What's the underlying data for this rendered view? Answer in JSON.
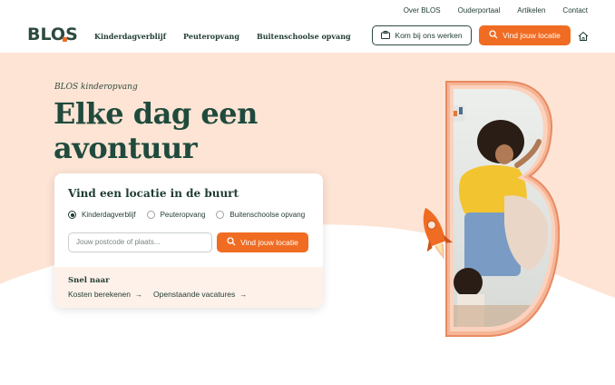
{
  "top_links": [
    "Over BLOS",
    "Ouderportaal",
    "Artikelen",
    "Contact"
  ],
  "logo": {
    "text": "BLOS"
  },
  "main_nav": [
    "Kinderdagverblijf",
    "Peuteropvang",
    "Buitenschoolse opvang"
  ],
  "header_buttons": {
    "work": "Kom bij ons werken",
    "find": "Vind jouw locatie"
  },
  "icons": {
    "work": "briefcase-icon",
    "find": "search-icon",
    "home": "house-icon"
  },
  "hero": {
    "eyebrow": "BLOS kinderopvang",
    "headline": "Elke dag een avontuur"
  },
  "search_card": {
    "title": "Vind een locatie in de buurt",
    "radios": [
      {
        "label": "Kinderdagverblijf",
        "selected": true
      },
      {
        "label": "Peuteropvang",
        "selected": false
      },
      {
        "label": "Buitenschoolse opvang",
        "selected": false
      }
    ],
    "input_placeholder": "Jouw postcode of plaats...",
    "button": "Vind jouw locatie",
    "quick_title": "Snel naar",
    "quick_links": [
      "Kosten berekenen",
      "Openstaande vacatures"
    ]
  },
  "colors": {
    "brand_green": "#1f4a3d",
    "accent_orange": "#f06c23",
    "hero_peach": "#fde4d4"
  }
}
